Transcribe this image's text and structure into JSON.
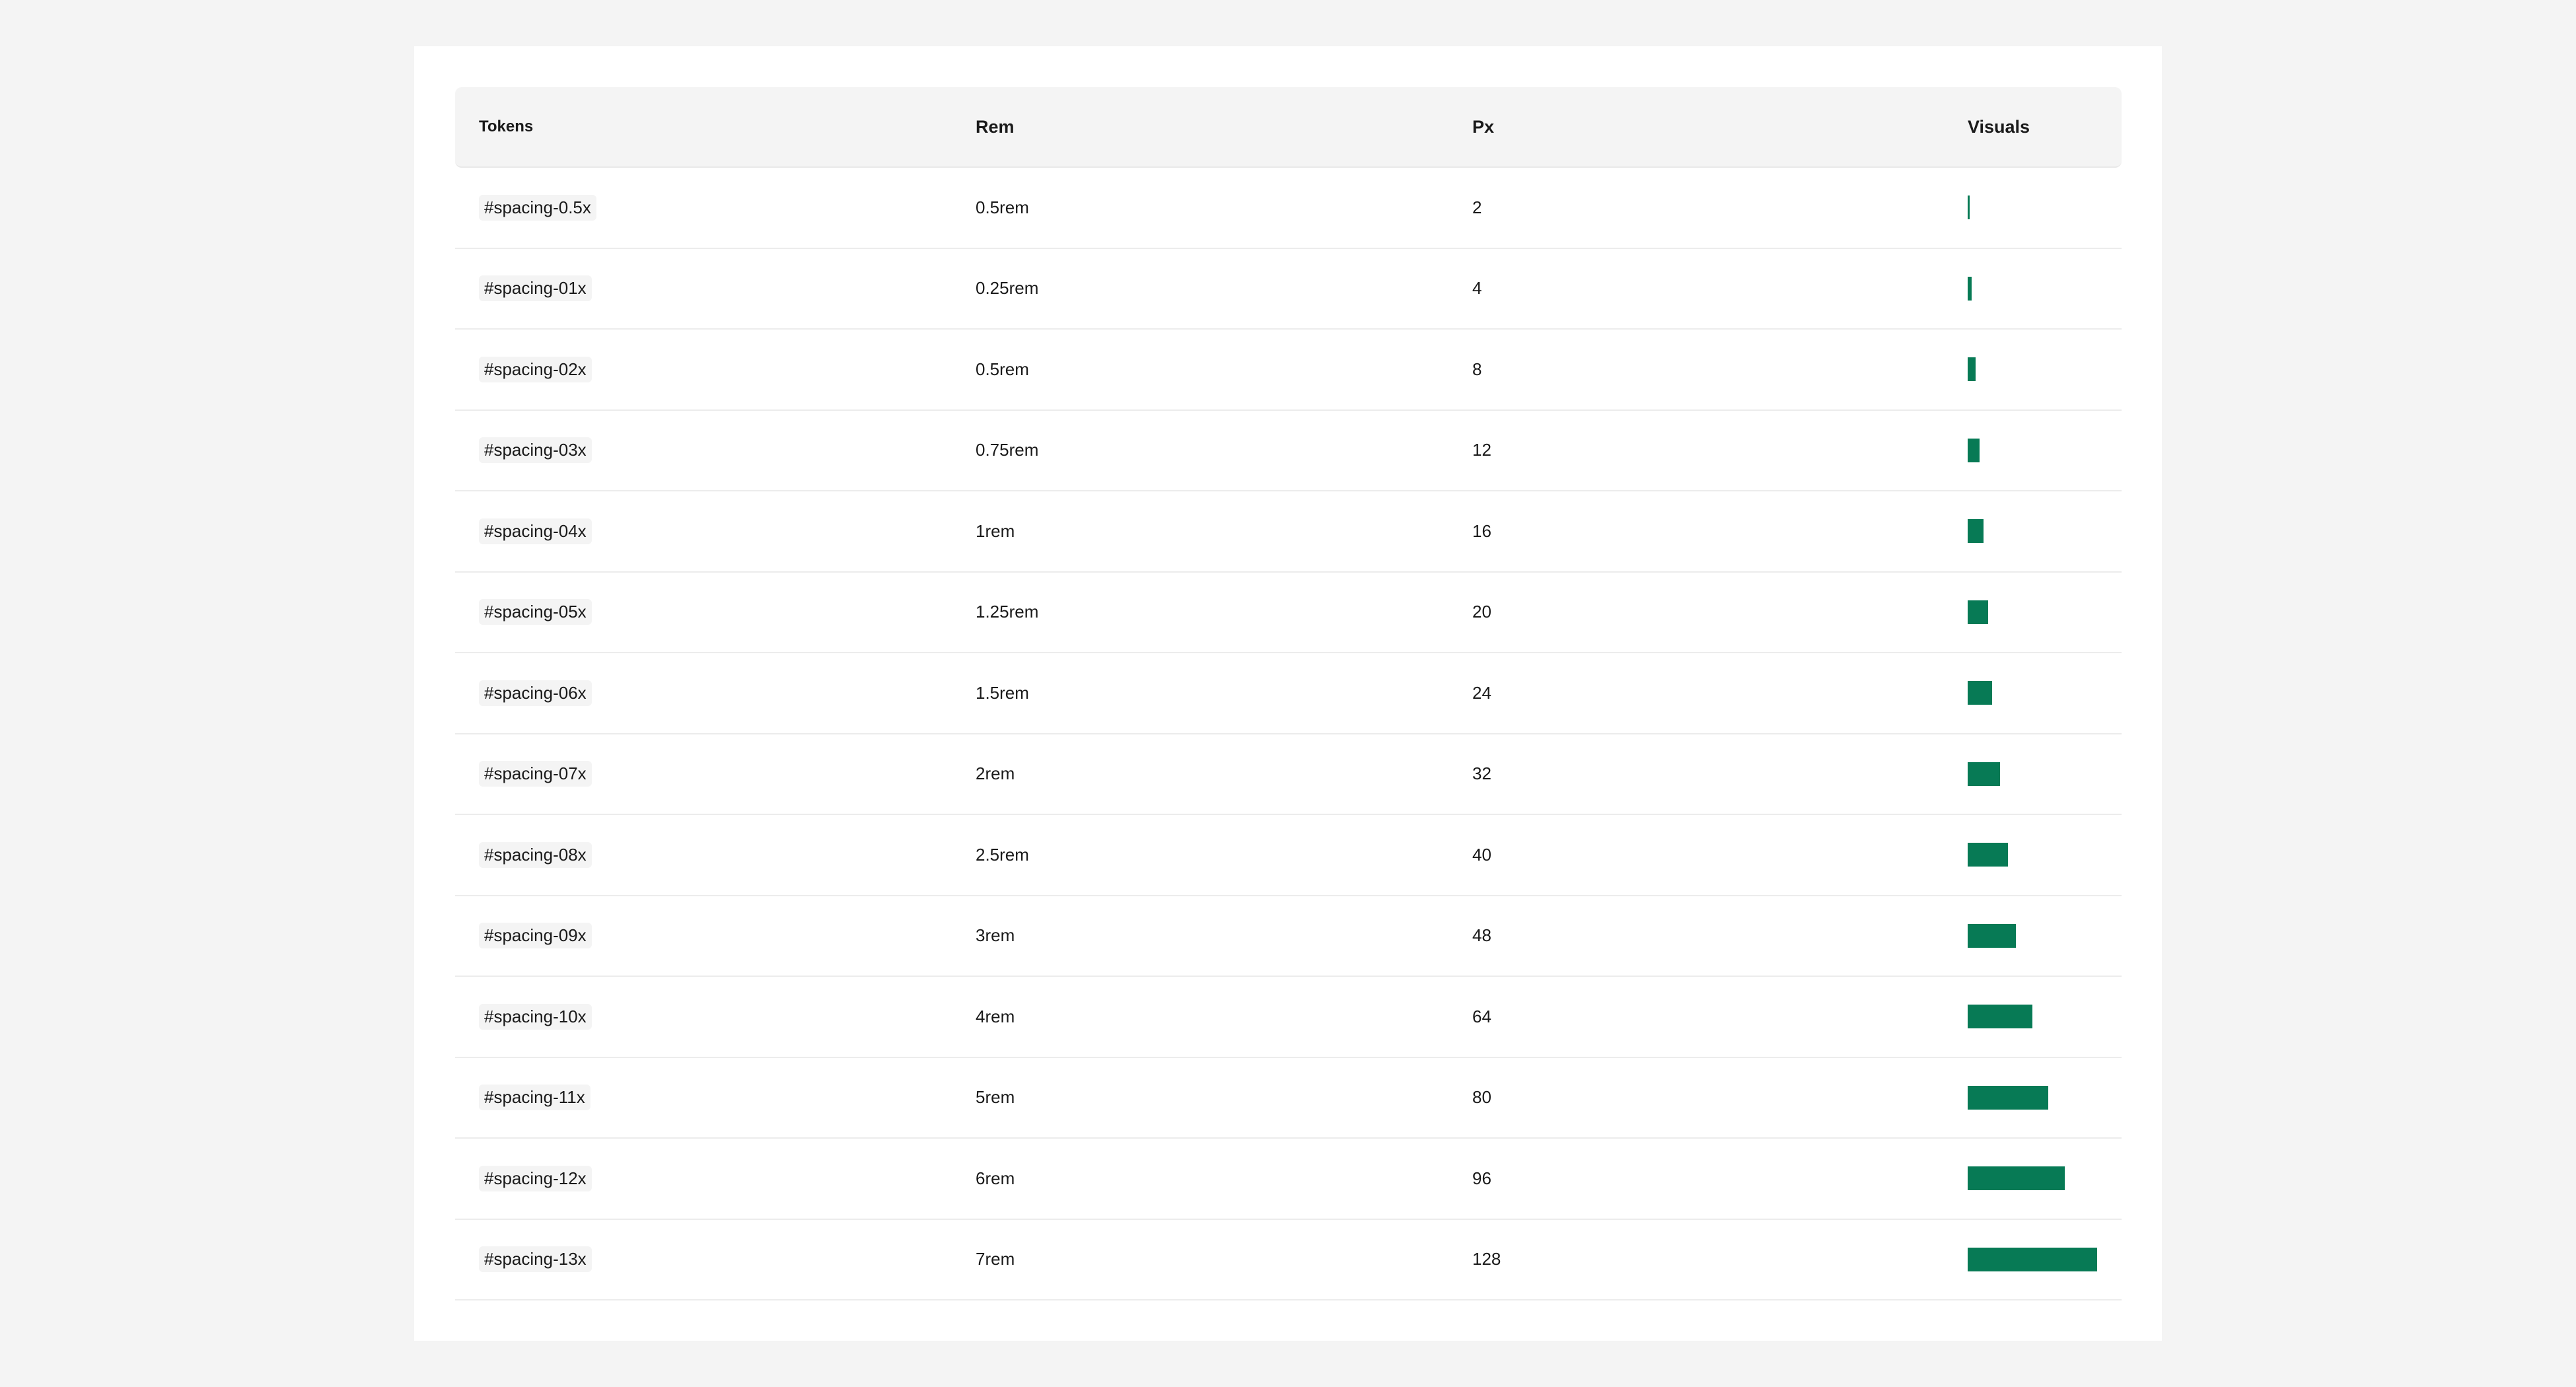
{
  "table": {
    "headers": [
      "Tokens",
      "Rem",
      "Px",
      "Visuals"
    ],
    "accent_color": "#077a55",
    "rows": [
      {
        "token": "#spacing-0.5x",
        "rem": "0.5rem",
        "px": "2"
      },
      {
        "token": "#spacing-01x",
        "rem": "0.25rem",
        "px": "4"
      },
      {
        "token": "#spacing-02x",
        "rem": "0.5rem",
        "px": "8"
      },
      {
        "token": "#spacing-03x",
        "rem": "0.75rem",
        "px": "12"
      },
      {
        "token": "#spacing-04x",
        "rem": "1rem",
        "px": "16"
      },
      {
        "token": "#spacing-05x",
        "rem": "1.25rem",
        "px": "20"
      },
      {
        "token": "#spacing-06x",
        "rem": "1.5rem",
        "px": "24"
      },
      {
        "token": "#spacing-07x",
        "rem": "2rem",
        "px": "32"
      },
      {
        "token": "#spacing-08x",
        "rem": "2.5rem",
        "px": "40"
      },
      {
        "token": "#spacing-09x",
        "rem": "3rem",
        "px": "48"
      },
      {
        "token": "#spacing-10x",
        "rem": "4rem",
        "px": "64"
      },
      {
        "token": "#spacing-11x",
        "rem": "5rem",
        "px": "80"
      },
      {
        "token": "#spacing-12x",
        "rem": "6rem",
        "px": "96"
      },
      {
        "token": "#spacing-13x",
        "rem": "7rem",
        "px": "128"
      }
    ]
  }
}
